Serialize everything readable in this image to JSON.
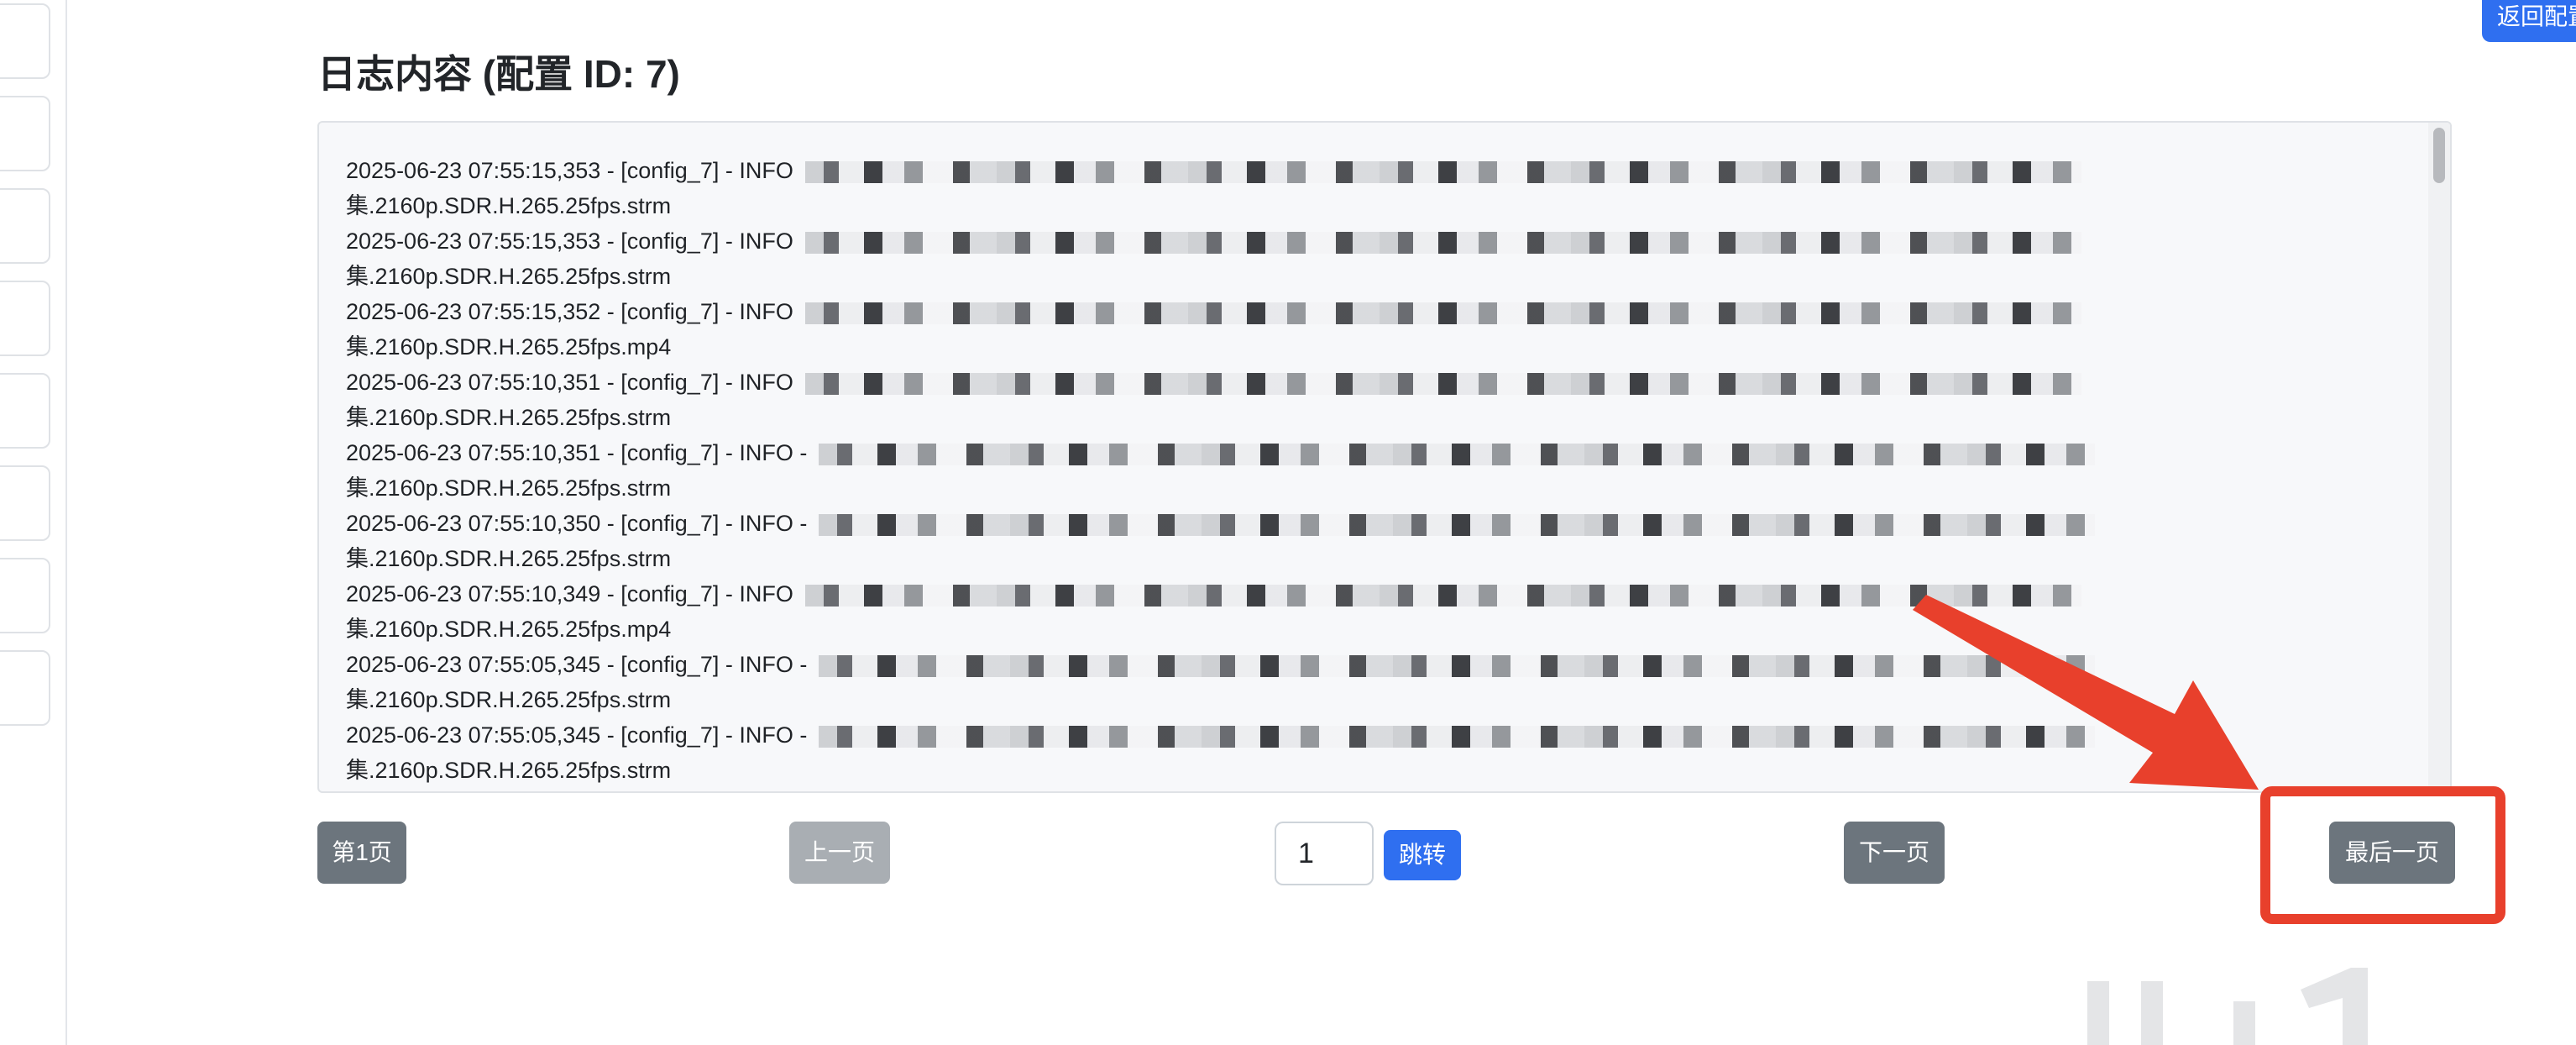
{
  "header": {
    "back_label": "返回配置",
    "title": "日志内容 (配置 ID: 7)"
  },
  "log": {
    "lines": [
      "2025-06-23 07:55:15,353 - [config_7] - INFO",
      "集.2160p.SDR.H.265.25fps.strm",
      "2025-06-23 07:55:15,353 - [config_7] - INFO",
      "集.2160p.SDR.H.265.25fps.strm",
      "2025-06-23 07:55:15,352 - [config_7] - INFO",
      "集.2160p.SDR.H.265.25fps.mp4",
      "2025-06-23 07:55:10,351 - [config_7] - INFO",
      "集.2160p.SDR.H.265.25fps.strm",
      "2025-06-23 07:55:10,351 - [config_7] - INFO -",
      "集.2160p.SDR.H.265.25fps.strm",
      "2025-06-23 07:55:10,350 - [config_7] - INFO -",
      "集.2160p.SDR.H.265.25fps.strm",
      "2025-06-23 07:55:10,349 - [config_7] - INFO",
      "集.2160p.SDR.H.265.25fps.mp4",
      "2025-06-23 07:55:05,345 - [config_7] - INFO -",
      "集.2160p.SDR.H.265.25fps.strm",
      "2025-06-23 07:55:05,345 - [config_7] - INFO -",
      "集.2160p.SDR.H.265.25fps.strm"
    ]
  },
  "pagination": {
    "first_label": "第1页",
    "prev_label": "上一页",
    "page_value": "1",
    "jump_label": "跳转",
    "next_label": "下一页",
    "last_label": "最后一页"
  },
  "colors": {
    "accent": "#2f6ff0",
    "button_dark": "#6c757d",
    "button_disabled": "#a9aeb3",
    "annotation_red": "#e8402c"
  }
}
